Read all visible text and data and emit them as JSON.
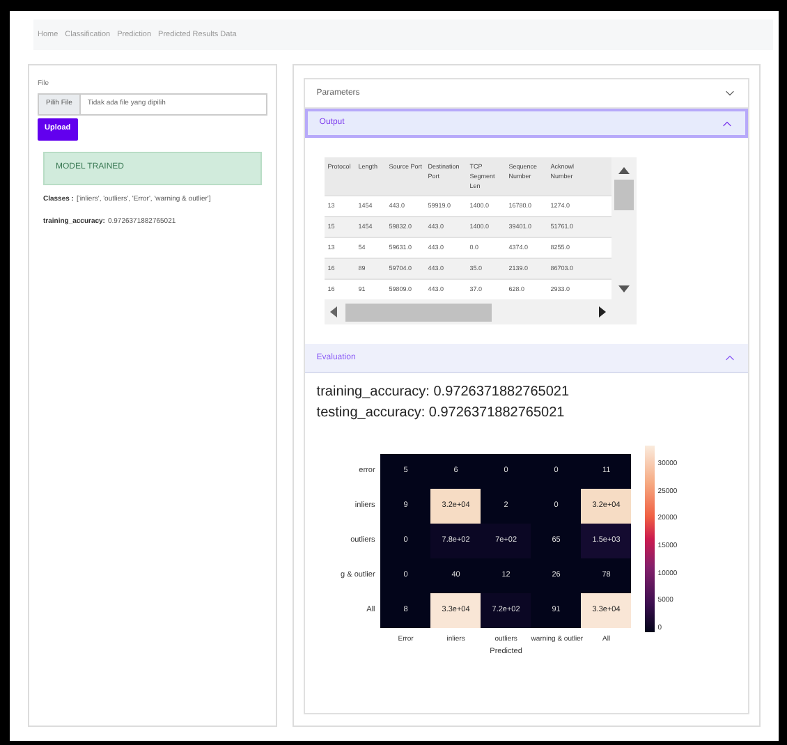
{
  "nav": [
    {
      "label": "Home"
    },
    {
      "label": "Classification"
    },
    {
      "label": "Prediction"
    },
    {
      "label": "Predicted Results Data"
    }
  ],
  "upload": {
    "label": "File",
    "browse": "Pilih File",
    "placeholder": "Tidak ada file yang dipilih",
    "button": "Upload"
  },
  "alert": "MODEL TRAINED",
  "results": [
    {
      "key": "Classes :",
      "value": "['inliers', 'outliers', 'Error', 'warning & outlier']"
    },
    {
      "key": "training_accuracy:",
      "value": "0.9726371882765021"
    }
  ],
  "accordion": [
    {
      "title": "Parameters",
      "expanded": false,
      "selected": false
    },
    {
      "kind": "table",
      "title": "Output",
      "expanded": true,
      "selected": true
    },
    {
      "kind": "evaluation",
      "title": "Evaluation",
      "expanded": true,
      "selected": false
    }
  ],
  "table": {
    "columns": [
      "Protocol",
      "Length",
      "Source Port",
      "Destination Port",
      "TCP Segment Len",
      "Sequence Number",
      "Acknowl Number"
    ],
    "rows": [
      [
        "13",
        "1454",
        "443.0",
        "59919.0",
        "1400.0",
        "16780.0",
        "1274.0"
      ],
      [
        "15",
        "1454",
        "59832.0",
        "443.0",
        "1400.0",
        "39401.0",
        "51761.0"
      ],
      [
        "13",
        "54",
        "59631.0",
        "443.0",
        "0.0",
        "4374.0",
        "8255.0"
      ],
      [
        "16",
        "89",
        "59704.0",
        "443.0",
        "35.0",
        "2139.0",
        "86703.0"
      ],
      [
        "16",
        "91",
        "59809.0",
        "443.0",
        "37.0",
        "628.0",
        "2933.0"
      ]
    ]
  },
  "evaluation": {
    "lines": [
      "training_accuracy: 0.9726371882765021",
      "testing_accuracy: 0.9726371882765021"
    ]
  },
  "heatmap": {
    "row_labels": [
      "error",
      "inliers",
      "outliers",
      "g & outlier",
      "All"
    ],
    "column_labels": [
      "Error",
      "inliers",
      "outliers",
      "warning & outlier",
      "All"
    ],
    "xlabel": "Predicted",
    "colorbar_ticks": [
      "30000",
      "25000",
      "20000",
      "15000",
      "10000",
      "5000",
      "0"
    ],
    "cells": [
      [
        {
          "text": "5",
          "color": "#03051a"
        },
        {
          "text": "6",
          "color": "#03051a"
        },
        {
          "text": "0",
          "color": "#03051a"
        },
        {
          "text": "0",
          "color": "#03051a"
        },
        {
          "text": "11",
          "color": "#03051a"
        }
      ],
      [
        {
          "text": "9",
          "color": "#03051a"
        },
        {
          "text": "3.2e+04",
          "color": "#f6dcc4"
        },
        {
          "text": "2",
          "color": "#03051a"
        },
        {
          "text": "0",
          "color": "#03051a"
        },
        {
          "text": "3.2e+04",
          "color": "#f6dcc4"
        }
      ],
      [
        {
          "text": "0",
          "color": "#03051a"
        },
        {
          "text": "7.8e+02",
          "color": "#0b0724"
        },
        {
          "text": "7e+02",
          "color": "#0b0724"
        },
        {
          "text": "65",
          "color": "#03051a"
        },
        {
          "text": "1.5e+03",
          "color": "#140b30"
        }
      ],
      [
        {
          "text": "0",
          "color": "#03051a"
        },
        {
          "text": "40",
          "color": "#03051a"
        },
        {
          "text": "12",
          "color": "#03051a"
        },
        {
          "text": "26",
          "color": "#03051a"
        },
        {
          "text": "78",
          "color": "#03051a"
        }
      ],
      [
        {
          "text": "8",
          "color": "#03051a"
        },
        {
          "text": "3.3e+04",
          "color": "#f9e6d6"
        },
        {
          "text": "7.2e+02",
          "color": "#0b0724"
        },
        {
          "text": "91",
          "color": "#03051a"
        },
        {
          "text": "3.3e+04",
          "color": "#f9e6d6"
        }
      ]
    ]
  }
}
